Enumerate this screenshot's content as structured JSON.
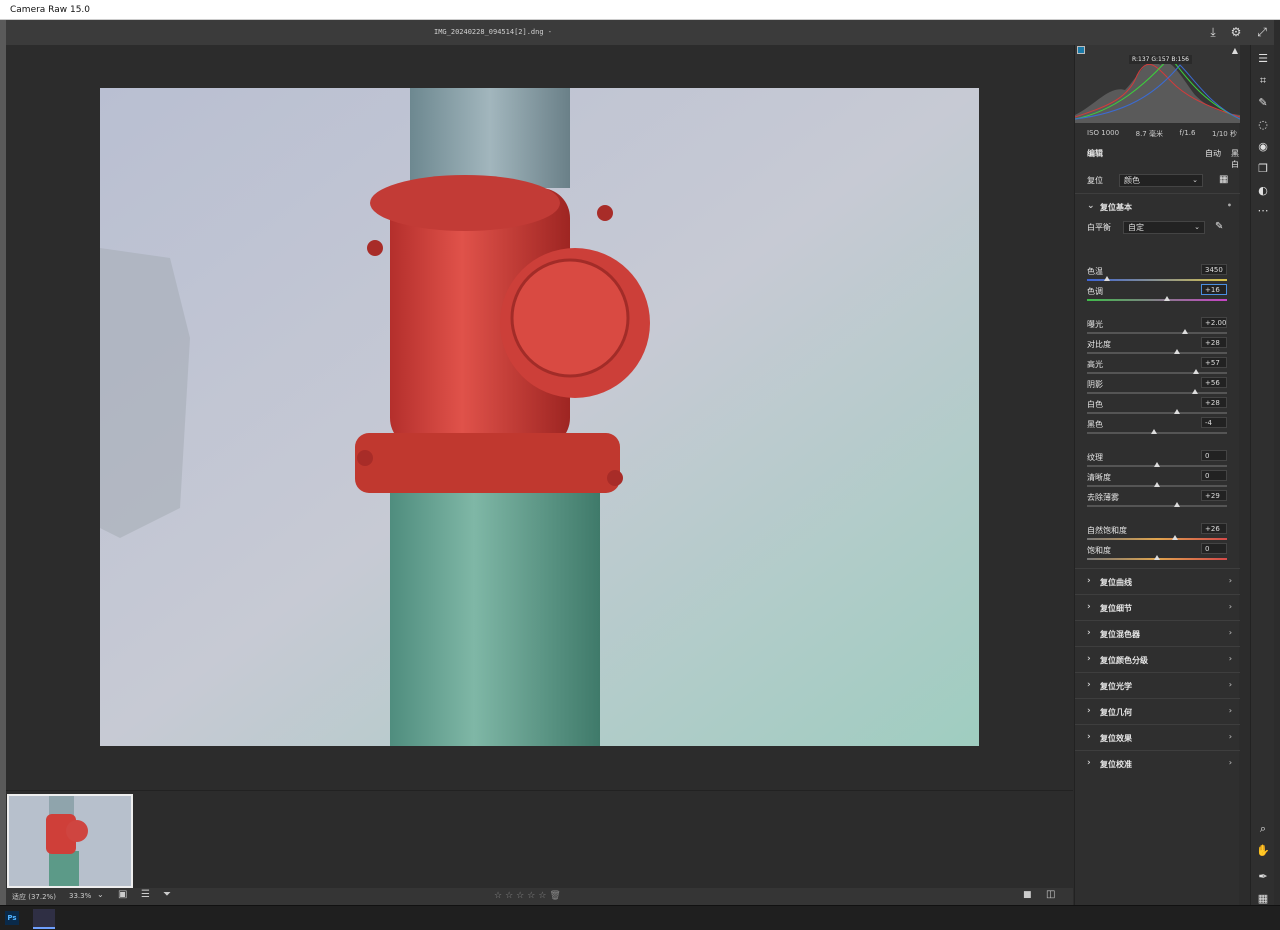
{
  "window": {
    "title": "Camera Raw 15.0"
  },
  "header": {
    "filename": "IMG_20240228_094514[2].dng - "
  },
  "histogram": {
    "rgb_readout": "R:137  G:157  B:156"
  },
  "exif": {
    "iso": "ISO 1000",
    "focal": "8.7 毫米",
    "aperture": "f/1.6",
    "shutter": "1/10 秒"
  },
  "edit": {
    "title": "编辑",
    "auto": "自动",
    "bw": "黑白"
  },
  "preset": {
    "label": "复位",
    "value": "颜色"
  },
  "basic": {
    "title": "复位基本",
    "wb_label": "白平衡",
    "wb_value": "自定",
    "sliders": [
      {
        "label": "色温",
        "value": "3450",
        "pos": 0.14
      },
      {
        "label": "色调",
        "value": "+16",
        "pos": 0.57
      },
      {
        "label": "曝光",
        "value": "+2.00",
        "pos": 0.7
      },
      {
        "label": "对比度",
        "value": "+28",
        "pos": 0.64
      },
      {
        "label": "高光",
        "value": "+57",
        "pos": 0.78
      },
      {
        "label": "阴影",
        "value": "+56",
        "pos": 0.77
      },
      {
        "label": "白色",
        "value": "+28",
        "pos": 0.64
      },
      {
        "label": "黑色",
        "value": "-4",
        "pos": 0.48
      },
      {
        "label": "纹理",
        "value": "0",
        "pos": 0.5
      },
      {
        "label": "清晰度",
        "value": "0",
        "pos": 0.5
      },
      {
        "label": "去除薄雾",
        "value": "+29",
        "pos": 0.64
      },
      {
        "label": "自然饱和度",
        "value": "+26",
        "pos": 0.63
      },
      {
        "label": "饱和度",
        "value": "0",
        "pos": 0.5
      }
    ]
  },
  "sections": [
    "复位曲线",
    "复位细节",
    "复位混色器",
    "复位颜色分级",
    "复位光学",
    "复位几何",
    "复位效果",
    "复位校准"
  ],
  "status": {
    "zoom_label": "适应 (37.2%)",
    "zoom_value": "33.3%"
  },
  "taskbar": {
    "ps": "Ps"
  }
}
